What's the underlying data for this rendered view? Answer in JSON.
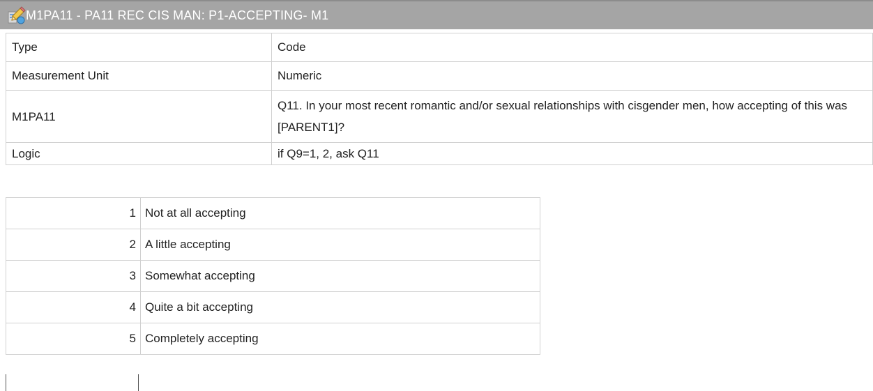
{
  "header": {
    "title": "M1PA11 - PA11 REC CIS MAN: P1-ACCEPTING- M1",
    "icon": "variable-pencil-icon"
  },
  "properties": [
    {
      "label": "Type",
      "value": "Code"
    },
    {
      "label": "Measurement Unit",
      "value": "Numeric"
    },
    {
      "label": "M1PA11",
      "value": "Q11. In your most recent romantic and/or sexual relationships with cisgender men, how accepting of this was [PARENT1]?"
    },
    {
      "label": "Logic",
      "value": "if Q9=1, 2, ask Q11"
    }
  ],
  "codes": [
    {
      "code": "1",
      "label": "Not at all accepting"
    },
    {
      "code": "2",
      "label": "A little accepting"
    },
    {
      "code": "3",
      "label": "Somewhat accepting"
    },
    {
      "code": "4",
      "label": "Quite a bit accepting"
    },
    {
      "code": "5",
      "label": "Completely accepting"
    }
  ]
}
